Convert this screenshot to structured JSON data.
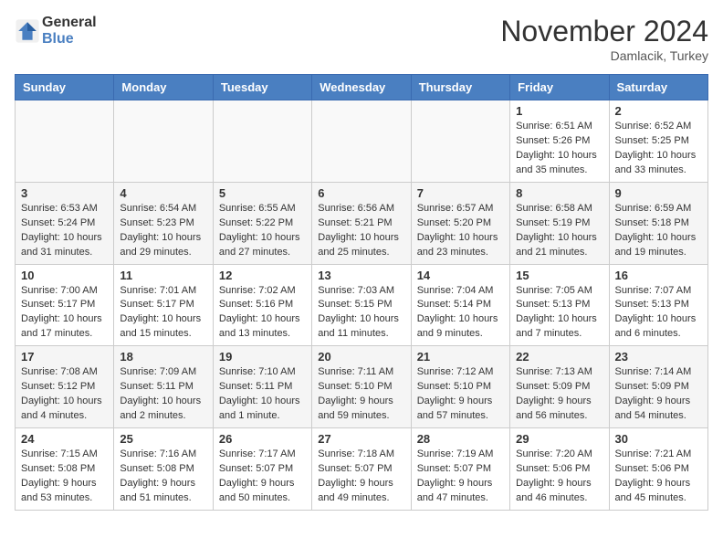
{
  "header": {
    "logo_general": "General",
    "logo_blue": "Blue",
    "month": "November 2024",
    "location": "Damlacik, Turkey"
  },
  "weekdays": [
    "Sunday",
    "Monday",
    "Tuesday",
    "Wednesday",
    "Thursday",
    "Friday",
    "Saturday"
  ],
  "weeks": [
    [
      {
        "day": "",
        "info": ""
      },
      {
        "day": "",
        "info": ""
      },
      {
        "day": "",
        "info": ""
      },
      {
        "day": "",
        "info": ""
      },
      {
        "day": "",
        "info": ""
      },
      {
        "day": "1",
        "info": "Sunrise: 6:51 AM\nSunset: 5:26 PM\nDaylight: 10 hours and 35 minutes."
      },
      {
        "day": "2",
        "info": "Sunrise: 6:52 AM\nSunset: 5:25 PM\nDaylight: 10 hours and 33 minutes."
      }
    ],
    [
      {
        "day": "3",
        "info": "Sunrise: 6:53 AM\nSunset: 5:24 PM\nDaylight: 10 hours and 31 minutes."
      },
      {
        "day": "4",
        "info": "Sunrise: 6:54 AM\nSunset: 5:23 PM\nDaylight: 10 hours and 29 minutes."
      },
      {
        "day": "5",
        "info": "Sunrise: 6:55 AM\nSunset: 5:22 PM\nDaylight: 10 hours and 27 minutes."
      },
      {
        "day": "6",
        "info": "Sunrise: 6:56 AM\nSunset: 5:21 PM\nDaylight: 10 hours and 25 minutes."
      },
      {
        "day": "7",
        "info": "Sunrise: 6:57 AM\nSunset: 5:20 PM\nDaylight: 10 hours and 23 minutes."
      },
      {
        "day": "8",
        "info": "Sunrise: 6:58 AM\nSunset: 5:19 PM\nDaylight: 10 hours and 21 minutes."
      },
      {
        "day": "9",
        "info": "Sunrise: 6:59 AM\nSunset: 5:18 PM\nDaylight: 10 hours and 19 minutes."
      }
    ],
    [
      {
        "day": "10",
        "info": "Sunrise: 7:00 AM\nSunset: 5:17 PM\nDaylight: 10 hours and 17 minutes."
      },
      {
        "day": "11",
        "info": "Sunrise: 7:01 AM\nSunset: 5:17 PM\nDaylight: 10 hours and 15 minutes."
      },
      {
        "day": "12",
        "info": "Sunrise: 7:02 AM\nSunset: 5:16 PM\nDaylight: 10 hours and 13 minutes."
      },
      {
        "day": "13",
        "info": "Sunrise: 7:03 AM\nSunset: 5:15 PM\nDaylight: 10 hours and 11 minutes."
      },
      {
        "day": "14",
        "info": "Sunrise: 7:04 AM\nSunset: 5:14 PM\nDaylight: 10 hours and 9 minutes."
      },
      {
        "day": "15",
        "info": "Sunrise: 7:05 AM\nSunset: 5:13 PM\nDaylight: 10 hours and 7 minutes."
      },
      {
        "day": "16",
        "info": "Sunrise: 7:07 AM\nSunset: 5:13 PM\nDaylight: 10 hours and 6 minutes."
      }
    ],
    [
      {
        "day": "17",
        "info": "Sunrise: 7:08 AM\nSunset: 5:12 PM\nDaylight: 10 hours and 4 minutes."
      },
      {
        "day": "18",
        "info": "Sunrise: 7:09 AM\nSunset: 5:11 PM\nDaylight: 10 hours and 2 minutes."
      },
      {
        "day": "19",
        "info": "Sunrise: 7:10 AM\nSunset: 5:11 PM\nDaylight: 10 hours and 1 minute."
      },
      {
        "day": "20",
        "info": "Sunrise: 7:11 AM\nSunset: 5:10 PM\nDaylight: 9 hours and 59 minutes."
      },
      {
        "day": "21",
        "info": "Sunrise: 7:12 AM\nSunset: 5:10 PM\nDaylight: 9 hours and 57 minutes."
      },
      {
        "day": "22",
        "info": "Sunrise: 7:13 AM\nSunset: 5:09 PM\nDaylight: 9 hours and 56 minutes."
      },
      {
        "day": "23",
        "info": "Sunrise: 7:14 AM\nSunset: 5:09 PM\nDaylight: 9 hours and 54 minutes."
      }
    ],
    [
      {
        "day": "24",
        "info": "Sunrise: 7:15 AM\nSunset: 5:08 PM\nDaylight: 9 hours and 53 minutes."
      },
      {
        "day": "25",
        "info": "Sunrise: 7:16 AM\nSunset: 5:08 PM\nDaylight: 9 hours and 51 minutes."
      },
      {
        "day": "26",
        "info": "Sunrise: 7:17 AM\nSunset: 5:07 PM\nDaylight: 9 hours and 50 minutes."
      },
      {
        "day": "27",
        "info": "Sunrise: 7:18 AM\nSunset: 5:07 PM\nDaylight: 9 hours and 49 minutes."
      },
      {
        "day": "28",
        "info": "Sunrise: 7:19 AM\nSunset: 5:07 PM\nDaylight: 9 hours and 47 minutes."
      },
      {
        "day": "29",
        "info": "Sunrise: 7:20 AM\nSunset: 5:06 PM\nDaylight: 9 hours and 46 minutes."
      },
      {
        "day": "30",
        "info": "Sunrise: 7:21 AM\nSunset: 5:06 PM\nDaylight: 9 hours and 45 minutes."
      }
    ]
  ]
}
